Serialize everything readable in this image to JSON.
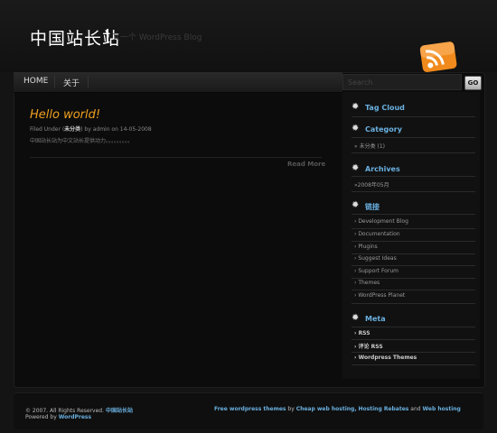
{
  "header": {
    "site_title": "中国站长站",
    "tagline": "又一个 WordPress Blog"
  },
  "nav": {
    "items": [
      "HOME",
      "关于"
    ]
  },
  "search": {
    "placeholder": "Search",
    "button": "GO"
  },
  "post": {
    "title": "Hello world!",
    "meta_prefix": "Filed Under (",
    "meta_category": "未分类",
    "meta_suffix": ") by admin on 14-05-2008",
    "excerpt": "中国站长站为中文站长提供动力。。。。。。。。。",
    "read_more": "Read More"
  },
  "sidebar": {
    "tag_cloud": "Tag Cloud",
    "category": {
      "title": "Category",
      "item": "» 未分类  (1)"
    },
    "archives": {
      "title": "Archives",
      "item": "»2008年05月"
    },
    "links": {
      "title": "链接",
      "items": [
        "Development Blog",
        "Documentation",
        "Plugins",
        "Suggest Ideas",
        "Support Forum",
        "Themes",
        "WordPress Planet"
      ]
    },
    "meta": {
      "title": "Meta",
      "items": [
        "RSS",
        "评论  RSS",
        "Wordpress Themes"
      ]
    }
  },
  "footer": {
    "copyright": "© 2007. All Rights Reserved.",
    "site_link": "中国站长站",
    "powered_by": "Powered by",
    "powered_link": "WordPress",
    "free_themes": "Free wordpress themes",
    "by": "by",
    "cheap_hosting": "Cheap web hosting,",
    "hosting_rebates": "Hosting Rebates",
    "and": "and",
    "web_hosting": "Web hosting"
  },
  "colors": {
    "accent": "#6ab0e0",
    "post_title": "#f0a020",
    "background": "#141414"
  }
}
